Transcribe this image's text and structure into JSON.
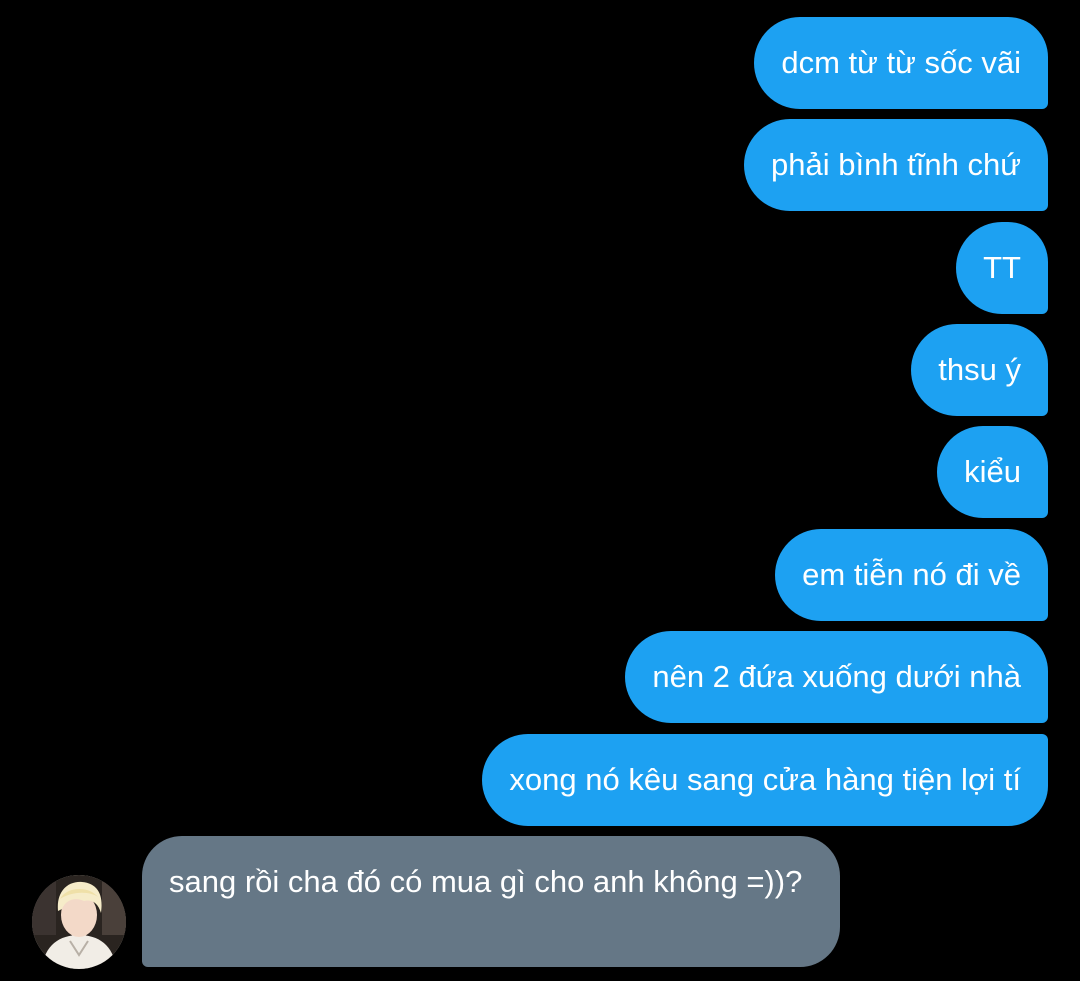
{
  "conversation": {
    "outgoing_messages": [
      {
        "text": "dcm từ từ sốc vãi"
      },
      {
        "text": "phải bình tĩnh chứ"
      },
      {
        "text": "TT"
      },
      {
        "text": "thsu ý"
      },
      {
        "text": "kiểu"
      },
      {
        "text": "em tiễn nó đi về"
      },
      {
        "text": "nên 2 đứa xuống dưới nhà"
      },
      {
        "text": "xong nó kêu sang cửa hàng tiện lợi tí"
      }
    ],
    "incoming_message": {
      "text": "sang rồi cha đó có mua gì cho anh không =))?"
    }
  },
  "colors": {
    "background": "#000000",
    "outgoing_bubble": "#1da1f2",
    "incoming_bubble": "#657786",
    "text": "#ffffff"
  }
}
